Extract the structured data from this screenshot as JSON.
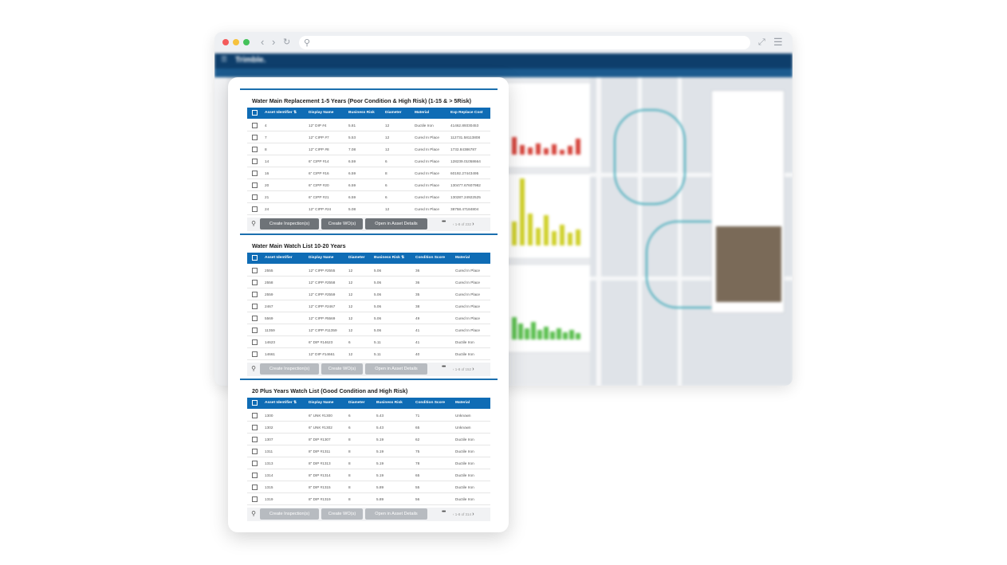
{
  "app": {
    "brand": "Trimble."
  },
  "sections": [
    {
      "title": "Water Main Replacement 1-5 Years (Poor Condition & High Risk) (1-15 & > 5Risk)",
      "columns": [
        "Asset Identifier ⇅",
        "Display Name",
        "Business Risk",
        "Diameter",
        "Material",
        "Exp Replace Cost"
      ],
      "rows": [
        [
          "4",
          "12\" DIP #4",
          "5.81",
          "12",
          "Ductile Iron",
          "41462.89330453"
        ],
        [
          "7",
          "12\" CIPP #7",
          "5.53",
          "12",
          "Cured In Place",
          "112731.58113808"
        ],
        [
          "8",
          "12\" CIPP #8",
          "7.08",
          "12",
          "Cured In Place",
          "1732.84386787"
        ],
        [
          "14",
          "6\" CIPP #14",
          "6.59",
          "6",
          "Cured In Place",
          "128239.01058664"
        ],
        [
          "16",
          "6\" CIPP #16",
          "6.59",
          "8",
          "Cured In Place",
          "60192.27443495"
        ],
        [
          "20",
          "6\" CIPP #20",
          "6.59",
          "6",
          "Cured In Place",
          "130477.67607982"
        ],
        [
          "21",
          "6\" CIPP #21",
          "6.59",
          "6",
          "Cured In Place",
          "130287.24922525"
        ],
        [
          "24",
          "12\" CIPP #24",
          "5.08",
          "12",
          "Cured In Place",
          "38758.47184804"
        ]
      ],
      "buttons": [
        "Create Inspection(s)",
        "Create WO(s)",
        "Open in Asset Details"
      ],
      "buttons_enabled": true,
      "more": "•••",
      "pager": "1-8 of 232"
    },
    {
      "title": "Water Main Watch List 10-20 Years",
      "columns": [
        "Asset Identifier",
        "Display Name",
        "Diameter",
        "Business Risk ⇅",
        "Condition Score",
        "Material"
      ],
      "rows": [
        [
          "2555",
          "12\" CIPP #2555",
          "12",
          "5.06",
          "36",
          "Cured In Place"
        ],
        [
          "2558",
          "12\" CIPP #2558",
          "12",
          "5.06",
          "36",
          "Cured In Place"
        ],
        [
          "2559",
          "12\" CIPP #2559",
          "12",
          "5.06",
          "35",
          "Cured In Place"
        ],
        [
          "2467",
          "12\" CIPP #2467",
          "12",
          "5.06",
          "38",
          "Cured In Place"
        ],
        [
          "5569",
          "12\" CIPP #5569",
          "12",
          "5.06",
          "49",
          "Cured In Place"
        ],
        [
          "11359",
          "12\" CIPP #11359",
          "12",
          "5.06",
          "41",
          "Cured In Place"
        ],
        [
          "14623",
          "6\" DIP #14623",
          "6",
          "5.11",
          "41",
          "Ductile Iron"
        ],
        [
          "14661",
          "12\" DIP #14661",
          "12",
          "5.11",
          "40",
          "Ductile Iron"
        ]
      ],
      "buttons": [
        "Create Inspection(s)",
        "Create WO(s)",
        "Open in Asset Details"
      ],
      "buttons_enabled": false,
      "more": "•••",
      "pager": "1-8 of 152"
    },
    {
      "title": "20 Plus Years Watch List (Good Condition and High Risk)",
      "columns": [
        "Asset Identifier ⇅",
        "Display Name",
        "Diameter",
        "Business Risk",
        "Condition Score",
        "Material"
      ],
      "rows": [
        [
          "1300",
          "6\" UNK #1300",
          "6",
          "5.43",
          "71",
          "Unknown"
        ],
        [
          "1302",
          "6\" UNK #1302",
          "6",
          "5.43",
          "65",
          "Unknown"
        ],
        [
          "1307",
          "8\" DIP #1307",
          "8",
          "5.19",
          "62",
          "Ductile Iron"
        ],
        [
          "1311",
          "8\" DIP #1311",
          "8",
          "5.19",
          "75",
          "Ductile Iron"
        ],
        [
          "1313",
          "8\" DIP #1313",
          "8",
          "5.19",
          "78",
          "Ductile Iron"
        ],
        [
          "1314",
          "8\" DIP #1314",
          "8",
          "5.19",
          "65",
          "Ductile Iron"
        ],
        [
          "1315",
          "8\" DIP #1315",
          "8",
          "5.89",
          "55",
          "Ductile Iron"
        ],
        [
          "1319",
          "8\" DIP #1319",
          "8",
          "5.89",
          "56",
          "Ductile Iron"
        ]
      ],
      "buttons": [
        "Create Inspection(s)",
        "Create WO(s)",
        "Open in Asset Details"
      ],
      "buttons_enabled": false,
      "more": "•••",
      "pager": "1-8 of 314"
    }
  ],
  "colors": {
    "grid_header": "#0f6cb5",
    "app_header": "#0e3e6b",
    "button_enabled": "#6e7378",
    "button_disabled": "#b7bbc0"
  },
  "icons": [
    "search-icon",
    "back-icon",
    "forward-icon",
    "reload-icon",
    "expand-icon",
    "menu-icon",
    "sort-icon",
    "checkbox",
    "chevron-left-icon",
    "chevron-right-icon"
  ]
}
